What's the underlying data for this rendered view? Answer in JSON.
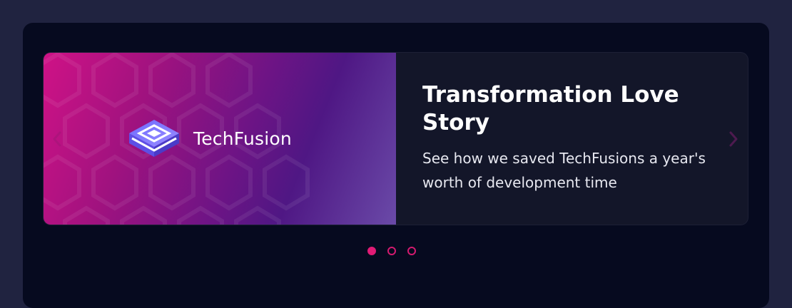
{
  "slider": {
    "slide": {
      "brand_name": "TechFusion",
      "title": "Transformation Love Story",
      "description": "See how we saved TechFusions a year's worth of development time"
    },
    "prev_icon": "chevron-left-icon",
    "next_icon": "chevron-right-icon",
    "pagination": {
      "total": 3,
      "active": 1
    }
  },
  "colors": {
    "page_background": "#202340",
    "panel_background": "#060a1f",
    "card_background": "#131629",
    "accent": "#e01b75",
    "gradient_start": "#cf1286",
    "gradient_end": "#6a4aa8"
  }
}
